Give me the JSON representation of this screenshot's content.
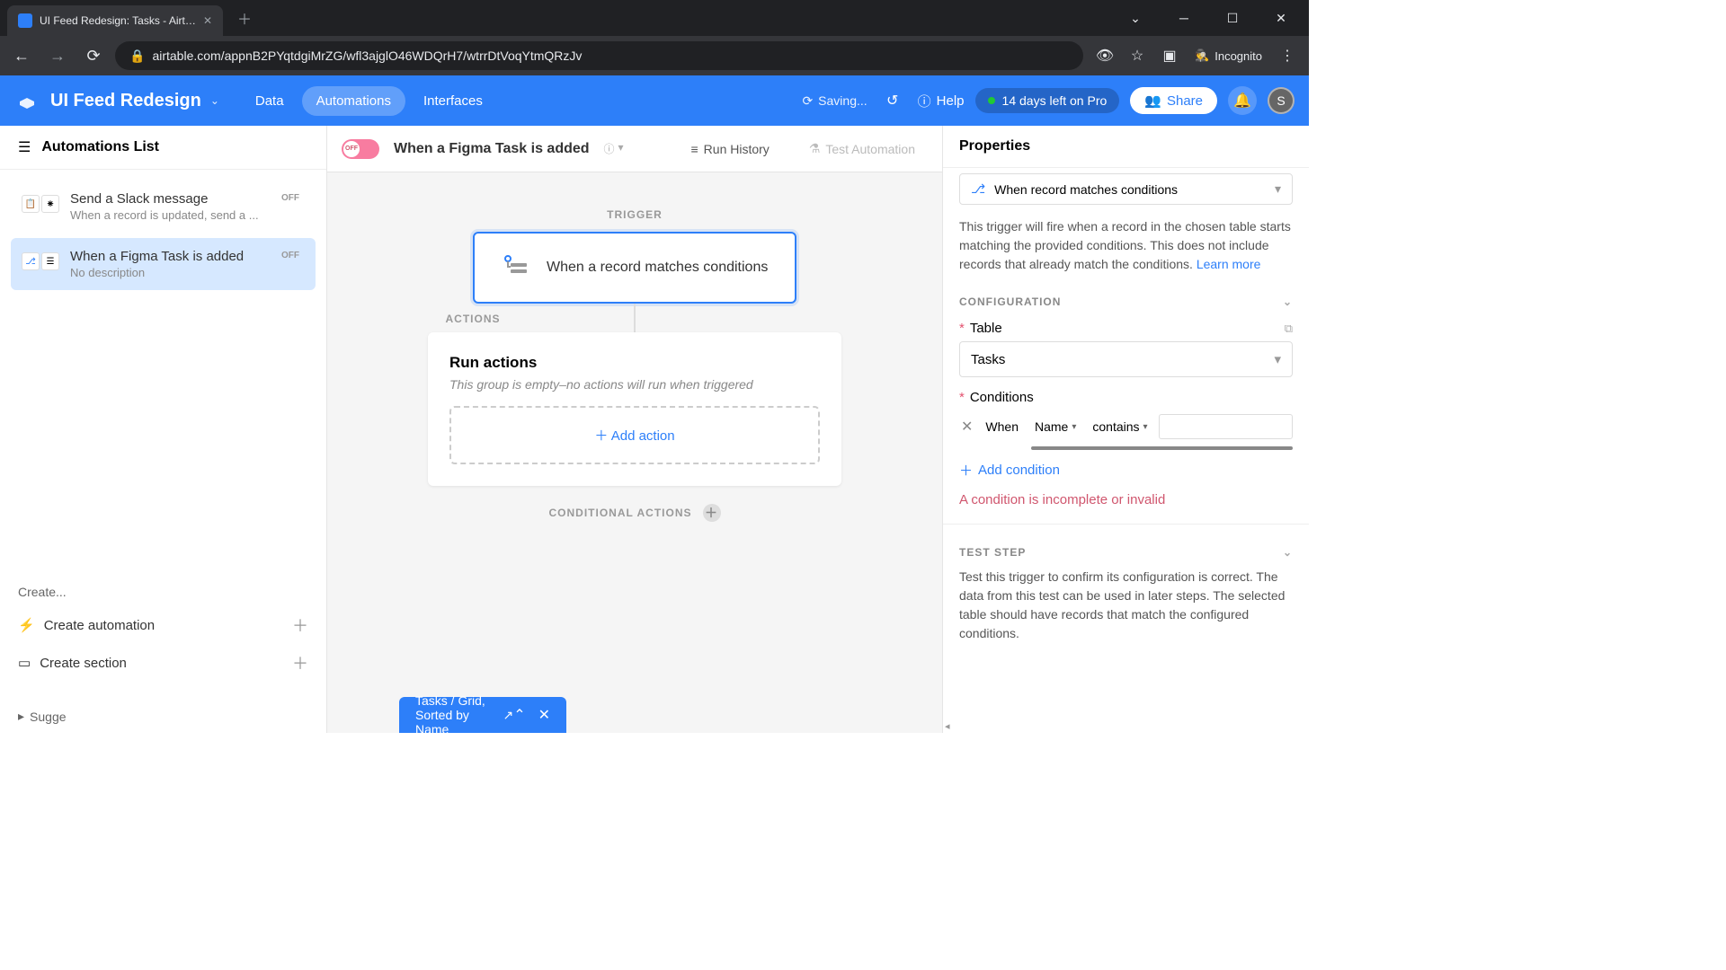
{
  "browser": {
    "tab_title": "UI Feed Redesign: Tasks - Airtabl",
    "url": "airtable.com/appnB2PYqtdgiMrZG/wfl3ajglO46WDQrH7/wtrrDtVoqYtmQRzJv",
    "incognito_label": "Incognito"
  },
  "header": {
    "app_title": "UI Feed Redesign",
    "nav": {
      "data": "Data",
      "automations": "Automations",
      "interfaces": "Interfaces"
    },
    "saving": "Saving...",
    "help": "Help",
    "trial": "14 days left on Pro",
    "share": "Share",
    "avatar_initial": "S"
  },
  "sidebar": {
    "title": "Automations List",
    "items": [
      {
        "name": "Send a Slack message",
        "desc": "When a record is updated, send a ...",
        "badge": "OFF"
      },
      {
        "name": "When a Figma Task is added",
        "desc": "No description",
        "badge": "OFF"
      }
    ],
    "create_label": "Create...",
    "create_automation": "Create automation",
    "create_section": "Create section",
    "suggested": "Sugge"
  },
  "canvas": {
    "toggle_text": "OFF",
    "title": "When a Figma Task is added",
    "run_history": "Run History",
    "test": "Test Automation",
    "trigger_label": "TRIGGER",
    "trigger_text": "When a record matches conditions",
    "actions_label": "ACTIONS",
    "actions_title": "Run actions",
    "actions_empty": "This group is empty–no actions will run when triggered",
    "add_action": "Add action",
    "conditional_label": "CONDITIONAL ACTIONS"
  },
  "props": {
    "title": "Properties",
    "trigger_name": "When record matches conditions",
    "description": "This trigger will fire when a record in the chosen table starts matching the provided conditions. This does not include records that already match the conditions. ",
    "learn_more": "Learn more",
    "config_label": "CONFIGURATION",
    "table_label": "Table",
    "table_value": "Tasks",
    "conditions_label": "Conditions",
    "cond_when": "When",
    "cond_field": "Name",
    "cond_op": "contains",
    "add_condition": "Add condition",
    "error": "A condition is incomplete or invalid",
    "test_label": "TEST STEP",
    "test_desc": "Test this trigger to confirm its configuration is correct. The data from this test can be used in later steps. The selected table should have records that match the configured conditions."
  },
  "toast": {
    "text": "Tasks / Grid, Sorted by Name"
  }
}
